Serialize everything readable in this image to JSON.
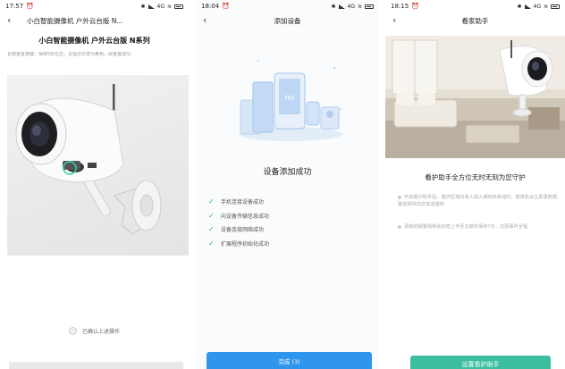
{
  "screens": [
    {
      "status": {
        "time": "17:57",
        "icons_text": "4G"
      },
      "nav": {
        "title": "小白智能摄像机 户外云台版 N..."
      },
      "heading": "小白智能摄像机 户外云台版 N系列",
      "instruction": "长按重置按键，保持5秒左右，至指示灯变为黄色，即重置成功",
      "confirm_label": "已确认上述操作"
    },
    {
      "status": {
        "time": "18:04",
        "icons_text": "4G"
      },
      "nav": {
        "title": "添加设备"
      },
      "success_title": "设备添加成功",
      "steps": [
        {
          "label": "手机连接设备成功"
        },
        {
          "label": "向设备传输信息成功"
        },
        {
          "label": "设备连接网络成功"
        },
        {
          "label": "扩展程序初始化成功"
        }
      ],
      "done_button": "完成 (3)"
    },
    {
      "status": {
        "time": "18:15",
        "icons_text": "4G"
      },
      "nav": {
        "title": "看家助手"
      },
      "heading": "看护助手全方位无时无刻为您守护",
      "bullets": [
        "开启看护助手后，看护区域内有人闯入或物体移动时，摄像机会立即录制报警视频并向您发送通知",
        "录制的报警视频会加密上传至云端并保存7天，还原事件全程"
      ],
      "setup_button": "设置看护助手"
    }
  ],
  "colors": {
    "accent_blue": "#2e96ec",
    "accent_green": "#3bbfa0",
    "check_green": "#2bb08a"
  }
}
